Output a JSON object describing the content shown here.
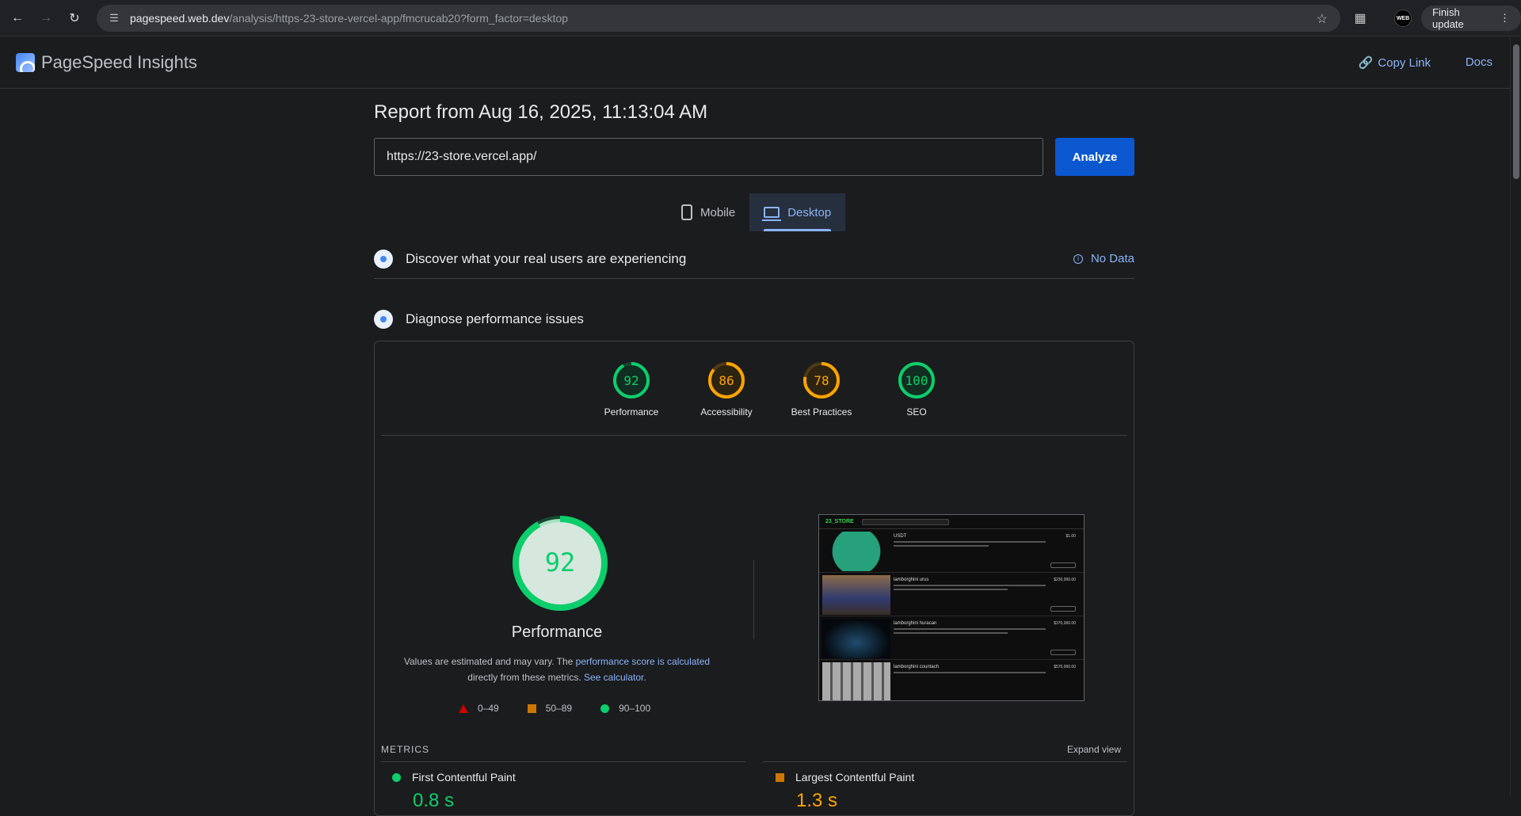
{
  "browser": {
    "url_host": "pagespeed.web.dev",
    "url_path": "/analysis/https-23-store-vercel-app/fmcrucab20?form_factor=desktop",
    "finish_update": "Finish update",
    "profile_label": "WEB"
  },
  "header": {
    "title": "PageSpeed Insights",
    "copy_link": "Copy Link",
    "docs": "Docs"
  },
  "report": {
    "title": "Report from Aug 16, 2025, 11:13:04 AM",
    "url_value": "https://23-store.vercel.app/",
    "analyze": "Analyze",
    "tabs": [
      {
        "label": "Mobile"
      },
      {
        "label": "Desktop"
      }
    ],
    "real_users": "Discover what your real users are experiencing",
    "no_data": "No Data",
    "diagnose": "Diagnose performance issues"
  },
  "scores": [
    {
      "value": "92",
      "label": "Performance",
      "color": "#0cce6b",
      "pct": 0.92
    },
    {
      "value": "86",
      "label": "Accessibility",
      "color": "#ffa400",
      "pct": 0.86
    },
    {
      "value": "78",
      "label": "Best Practices",
      "color": "#ffa400",
      "pct": 0.78
    },
    {
      "value": "100",
      "label": "SEO",
      "color": "#0cce6b",
      "pct": 1.0
    }
  ],
  "performance": {
    "score": "92",
    "title": "Performance",
    "desc_1": "Values are estimated and may vary. The ",
    "desc_link1": "performance score is calculated",
    "desc_2": " directly from these metrics. ",
    "desc_link2": "See calculator.",
    "legend": [
      "0–49",
      "50–89",
      "90–100"
    ]
  },
  "screenshot": {
    "logo": "23_STORE",
    "items": [
      {
        "name": "USDT",
        "price": "$1.00"
      },
      {
        "name": "lamborghini urus",
        "price": "$230,000.00"
      },
      {
        "name": "lamborghini huracan",
        "price": "$370,000.00"
      },
      {
        "name": "lamborghini countach",
        "price": "$570,000.00"
      }
    ]
  },
  "metrics": {
    "label": "METRICS",
    "expand": "Expand view",
    "fcp_label": "First Contentful Paint",
    "fcp_value": "0.8 s",
    "lcp_label": "Largest Contentful Paint",
    "lcp_value": "1.3 s"
  },
  "colors": {
    "accent": "#8ab4f8",
    "pass": "#0cce6b",
    "average": "#ffa400",
    "fail": "#cc0000"
  }
}
